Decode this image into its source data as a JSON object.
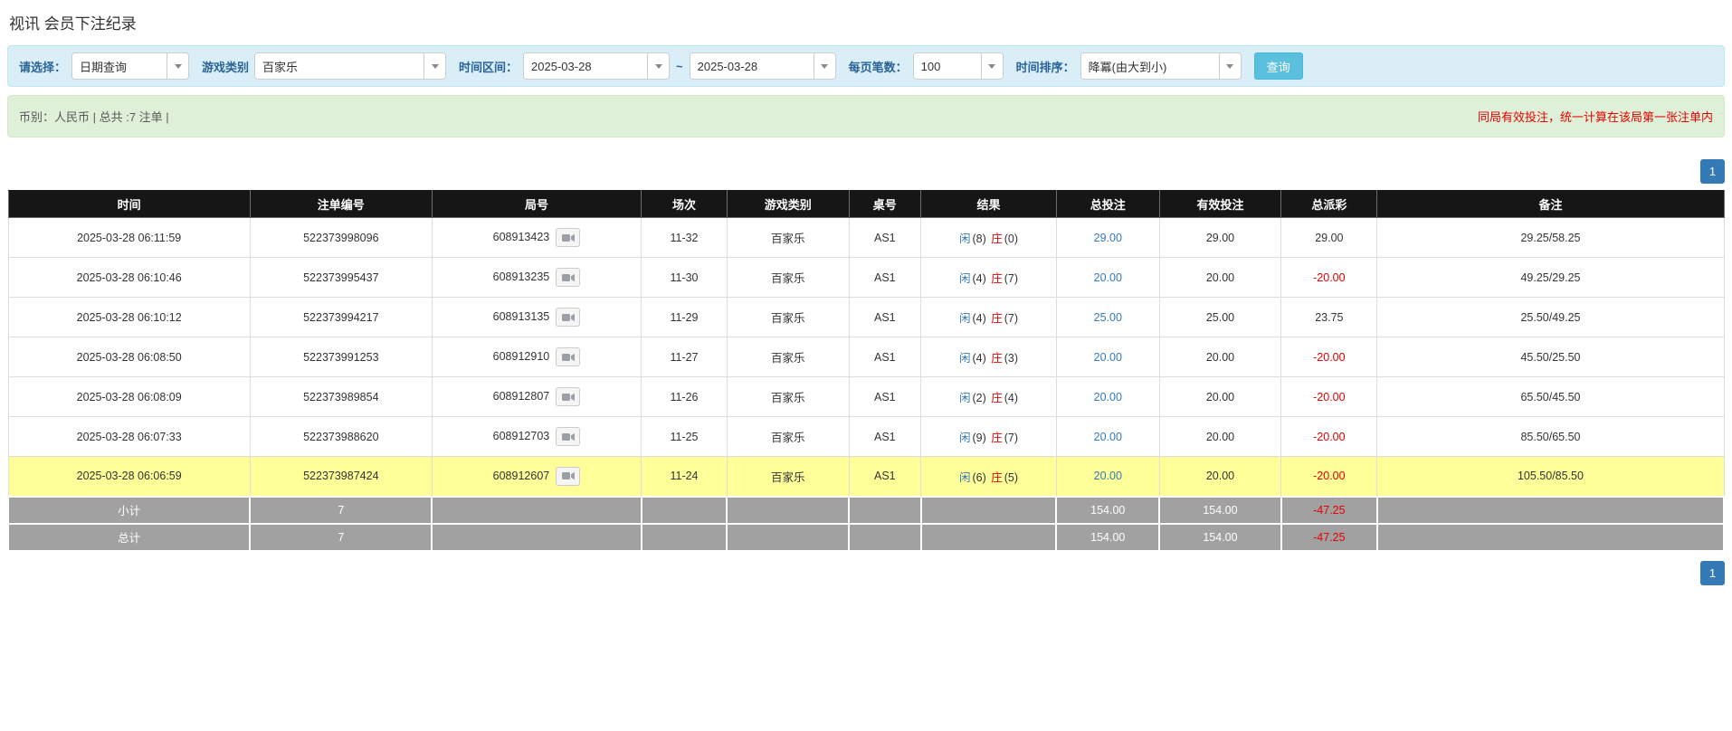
{
  "page_title": "视讯 会员下注纪录",
  "filters": {
    "select_label": "请选择：",
    "select_value": "日期查询",
    "game_label": "游戏类别",
    "game_value": "百家乐",
    "range_label": "时间区间：",
    "date_from": "2025-03-28",
    "range_separator": "~",
    "date_to": "2025-03-28",
    "per_page_label": "每页笔数：",
    "per_page_value": "100",
    "sort_label": "时间排序：",
    "sort_value": "降冪(由大到小)",
    "query_button": "查询"
  },
  "summary": {
    "left_text": "币别：人民币 | 总共 :7 注单 |",
    "right_text": "同局有效投注，统一计算在该局第一张注单内"
  },
  "pagination": {
    "page_label": "1"
  },
  "table": {
    "headers": [
      "时间",
      "注单编号",
      "局号",
      "场次",
      "游戏类别",
      "桌号",
      "结果",
      "总投注",
      "有效投注",
      "总派彩",
      "备注"
    ],
    "rows": [
      {
        "time": "2025-03-28 06:11:59",
        "bet_no": "522373998096",
        "round_no": "608913423",
        "session": "11-32",
        "game": "百家乐",
        "table_no": "AS1",
        "player_label": "闲",
        "player_score": "(8)",
        "banker_label": "庄",
        "banker_score": "(0)",
        "total_bet": "29.00",
        "valid_bet": "29.00",
        "payout": "29.00",
        "remark": "29.25/58.25"
      },
      {
        "time": "2025-03-28 06:10:46",
        "bet_no": "522373995437",
        "round_no": "608913235",
        "session": "11-30",
        "game": "百家乐",
        "table_no": "AS1",
        "player_label": "闲",
        "player_score": "(4)",
        "banker_label": "庄",
        "banker_score": "(7)",
        "total_bet": "20.00",
        "valid_bet": "20.00",
        "payout": "-20.00",
        "remark": "49.25/29.25"
      },
      {
        "time": "2025-03-28 06:10:12",
        "bet_no": "522373994217",
        "round_no": "608913135",
        "session": "11-29",
        "game": "百家乐",
        "table_no": "AS1",
        "player_label": "闲",
        "player_score": "(4)",
        "banker_label": "庄",
        "banker_score": "(7)",
        "total_bet": "25.00",
        "valid_bet": "25.00",
        "payout": "23.75",
        "remark": "25.50/49.25"
      },
      {
        "time": "2025-03-28 06:08:50",
        "bet_no": "522373991253",
        "round_no": "608912910",
        "session": "11-27",
        "game": "百家乐",
        "table_no": "AS1",
        "player_label": "闲",
        "player_score": "(4)",
        "banker_label": "庄",
        "banker_score": "(3)",
        "total_bet": "20.00",
        "valid_bet": "20.00",
        "payout": "-20.00",
        "remark": "45.50/25.50"
      },
      {
        "time": "2025-03-28 06:08:09",
        "bet_no": "522373989854",
        "round_no": "608912807",
        "session": "11-26",
        "game": "百家乐",
        "table_no": "AS1",
        "player_label": "闲",
        "player_score": "(2)",
        "banker_label": "庄",
        "banker_score": "(4)",
        "total_bet": "20.00",
        "valid_bet": "20.00",
        "payout": "-20.00",
        "remark": "65.50/45.50"
      },
      {
        "time": "2025-03-28 06:07:33",
        "bet_no": "522373988620",
        "round_no": "608912703",
        "session": "11-25",
        "game": "百家乐",
        "table_no": "AS1",
        "player_label": "闲",
        "player_score": "(9)",
        "banker_label": "庄",
        "banker_score": "(7)",
        "total_bet": "20.00",
        "valid_bet": "20.00",
        "payout": "-20.00",
        "remark": "85.50/65.50"
      },
      {
        "time": "2025-03-28 06:06:59",
        "bet_no": "522373987424",
        "round_no": "608912607",
        "session": "11-24",
        "game": "百家乐",
        "table_no": "AS1",
        "player_label": "闲",
        "player_score": "(6)",
        "banker_label": "庄",
        "banker_score": "(5)",
        "total_bet": "20.00",
        "valid_bet": "20.00",
        "payout": "-20.00",
        "remark": "105.50/85.50"
      }
    ],
    "subtotal": {
      "label": "小计",
      "count": "7",
      "total_bet": "154.00",
      "valid_bet": "154.00",
      "payout": "-47.25"
    },
    "grand_total": {
      "label": "总计",
      "count": "7",
      "total_bet": "154.00",
      "valid_bet": "154.00",
      "payout": "-47.25"
    }
  },
  "colors": {
    "accent_blue": "#337ab7",
    "negative_red": "#e60000",
    "highlight_yellow": "#ffff99",
    "header_black": "#161616",
    "footer_gray": "#a1a1a1"
  }
}
